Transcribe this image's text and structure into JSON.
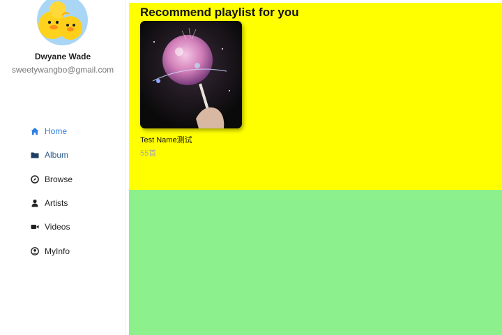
{
  "user": {
    "name": "Dwyane Wade",
    "email": "sweetywangbo@gmail.com"
  },
  "nav": {
    "items": [
      {
        "label": "Home",
        "icon": "home-icon",
        "active": true
      },
      {
        "label": "Album",
        "icon": "folder-icon"
      },
      {
        "label": "Browse",
        "icon": "compass-icon"
      },
      {
        "label": "Artists",
        "icon": "user-icon"
      },
      {
        "label": "Videos",
        "icon": "video-camera-icon"
      },
      {
        "label": "MyInfo",
        "icon": "user-circle-icon"
      }
    ]
  },
  "main": {
    "title": "Recommend playlist for you",
    "playlists": [
      {
        "title": "Test Name测试",
        "count": "55首"
      }
    ]
  },
  "colors": {
    "top_panel": "#ffff00",
    "bottom_panel": "#8cf08c",
    "active_nav": "#2f7fe0"
  }
}
